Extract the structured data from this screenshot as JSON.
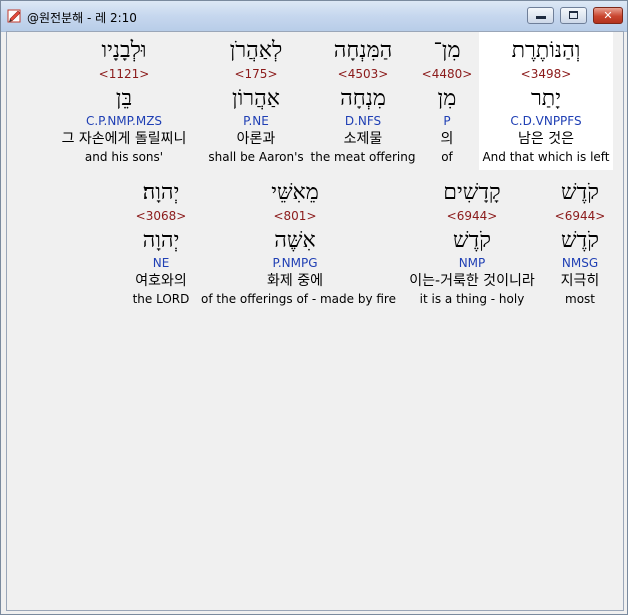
{
  "window": {
    "title": "@원전분해 - 레 2:10",
    "minimize_glyph": "",
    "maximize_glyph": "",
    "close_glyph": "✕"
  },
  "words": [
    {
      "hebrew": "וְהַנּוֹתֶרֶת",
      "strong": "<3498>",
      "lemma": "יָתַר",
      "parse": "C.D.VNPPFS",
      "korean": "남은 것은",
      "english": "And that which is left"
    },
    {
      "hebrew": "מִן־",
      "strong": "<4480>",
      "lemma": "מִן",
      "parse": "P",
      "korean": "의",
      "english": "of"
    },
    {
      "hebrew": "הַמִּנְחָה",
      "strong": "<4503>",
      "lemma": "מִנְחָה",
      "parse": "D.NFS",
      "korean": "소제물",
      "english": "the meat offering"
    },
    {
      "hebrew": "לְאַהֲרֹן",
      "strong": "<175>",
      "lemma": "אַהֲרוֹן",
      "parse": "P.NE",
      "korean": "아론과",
      "english": "shall be Aaron's"
    },
    {
      "hebrew": "וּלְבָנָיו",
      "strong": "<1121>",
      "lemma": "בֵּן",
      "parse": "C.P.NMP.MZS",
      "korean": "그 자손에게 돌릴찌니",
      "english": "and his sons'"
    },
    {
      "hebrew": "קֹדֶשׁ",
      "strong": "<6944>",
      "lemma": "קֹדֶשׁ",
      "parse": "NMSG",
      "korean": "지극히",
      "english": "most"
    },
    {
      "hebrew": "קָדָשִׁים",
      "strong": "<6944>",
      "lemma": "קֹדֶשׁ",
      "parse": "NMP",
      "korean": "이는-거룩한 것이니라",
      "english": "it is a thing - holy"
    },
    {
      "hebrew": "מֵאִשֵּׁי",
      "strong": "<801>",
      "lemma": "אִשֶּׁה",
      "parse": "P.NMPG",
      "korean": "화제 중에",
      "english": "of the offerings of - made by fire"
    },
    {
      "hebrew": "יְהוָה׃",
      "strong": "<3068>",
      "lemma": "יְהוָה",
      "parse": "NE",
      "korean": "여호와의",
      "english": "the LORD"
    }
  ]
}
